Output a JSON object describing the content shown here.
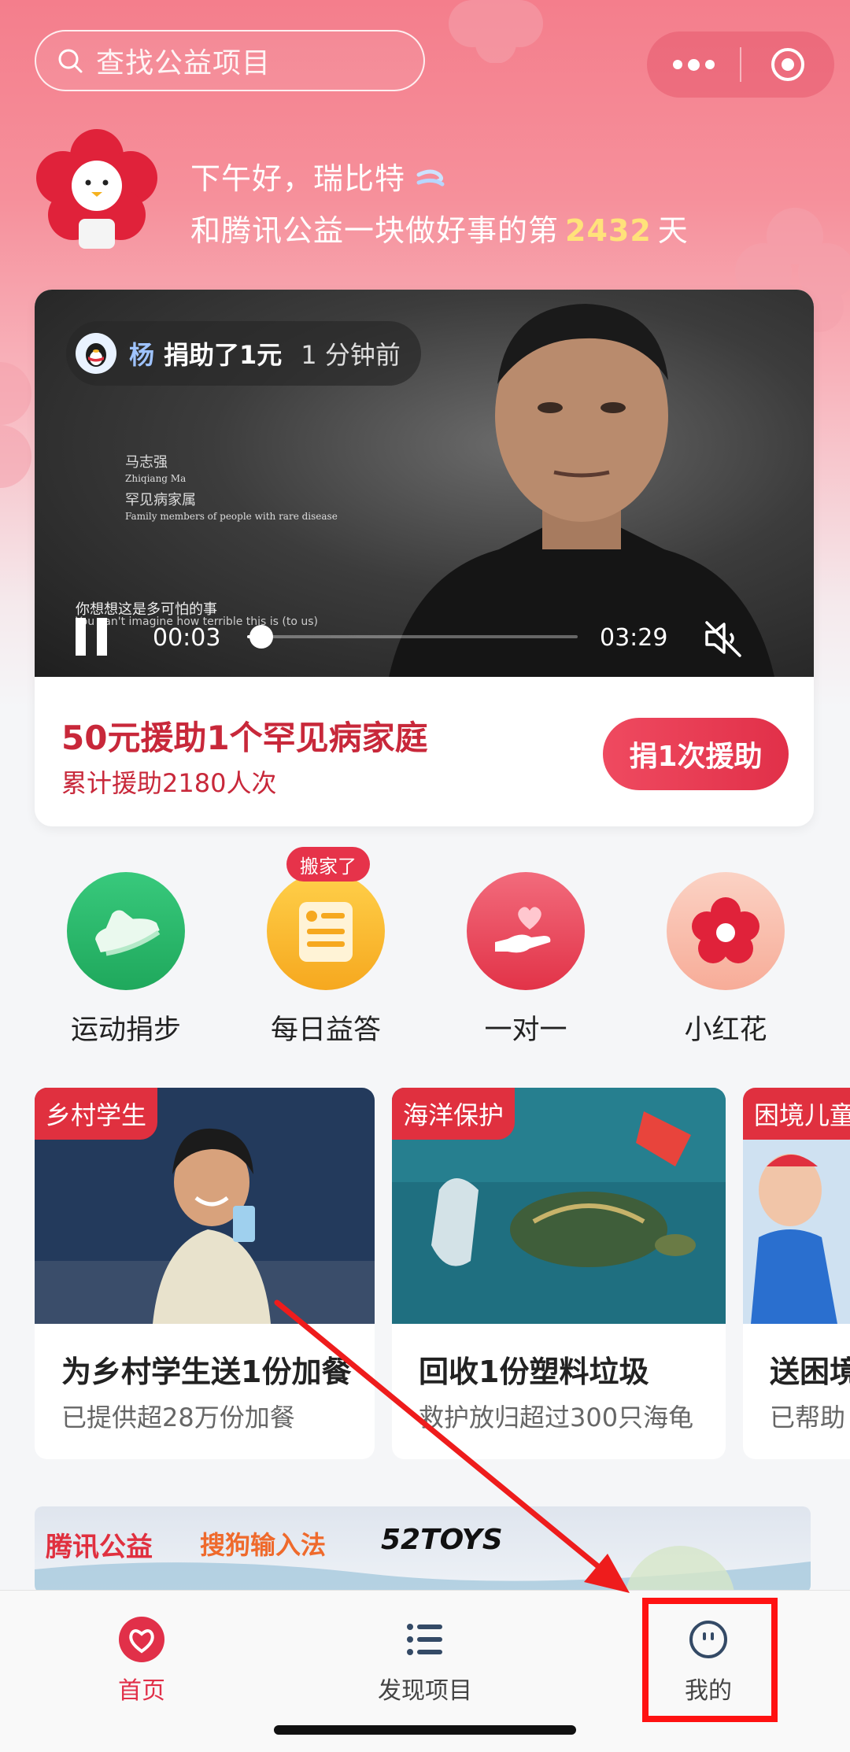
{
  "search": {
    "placeholder": "查找公益项目"
  },
  "greeting": {
    "line1": "下午好，瑞比特",
    "line2_prefix": "和腾讯公益一块做好事的第",
    "days": "2432",
    "line2_suffix": "天"
  },
  "video": {
    "donor_name": "杨",
    "donor_action": "捐助了1元",
    "donor_time": "1 分钟前",
    "caption_name_cn": "马志强",
    "caption_name_en": "Zhiqiang Ma",
    "caption_role_cn": "罕见病家属",
    "caption_role_en": "Family members of people with rare disease",
    "subtitle_cn": "你想想这是多可怕的事",
    "subtitle_en": "You can't imagine how terrible this is (to us)",
    "current_time": "00:03",
    "duration": "03:29",
    "progress": 0.015
  },
  "project": {
    "title": "50元援助1个罕见病家庭",
    "subtitle": "累计援助2180人次",
    "button": "捐1次援助"
  },
  "quick_actions": [
    {
      "label": "运动捐步",
      "icon": "sneaker-icon",
      "color": "#2dbd6e"
    },
    {
      "label": "每日益答",
      "icon": "quiz-notebook-icon",
      "color": "#f7b52c",
      "badge": "搬家了"
    },
    {
      "label": "一对一",
      "icon": "heart-hand-icon",
      "color": "#ec4257"
    },
    {
      "label": "小红花",
      "icon": "red-flower-icon",
      "color": "#f8b9a6"
    }
  ],
  "cards": [
    {
      "tag": "乡村学生",
      "title": "为乡村学生送1份加餐",
      "sub": "已提供超28万份加餐"
    },
    {
      "tag": "海洋保护",
      "title": "回收1份塑料垃圾",
      "sub": "救护放归超过300只海龟"
    },
    {
      "tag": "困境儿童",
      "title": "送困境",
      "sub": "已帮助"
    }
  ],
  "banner": {
    "brand1": "腾讯公益",
    "brand2": "搜狗输入法",
    "brand3": "52TOYS"
  },
  "nav": [
    {
      "label": "首页",
      "icon": "home-heart-icon",
      "active": true
    },
    {
      "label": "发现项目",
      "icon": "list-icon",
      "active": false
    },
    {
      "label": "我的",
      "icon": "profile-face-icon",
      "active": false
    }
  ],
  "colors": {
    "accent": "#e13049",
    "annotation": "#ff1212"
  }
}
